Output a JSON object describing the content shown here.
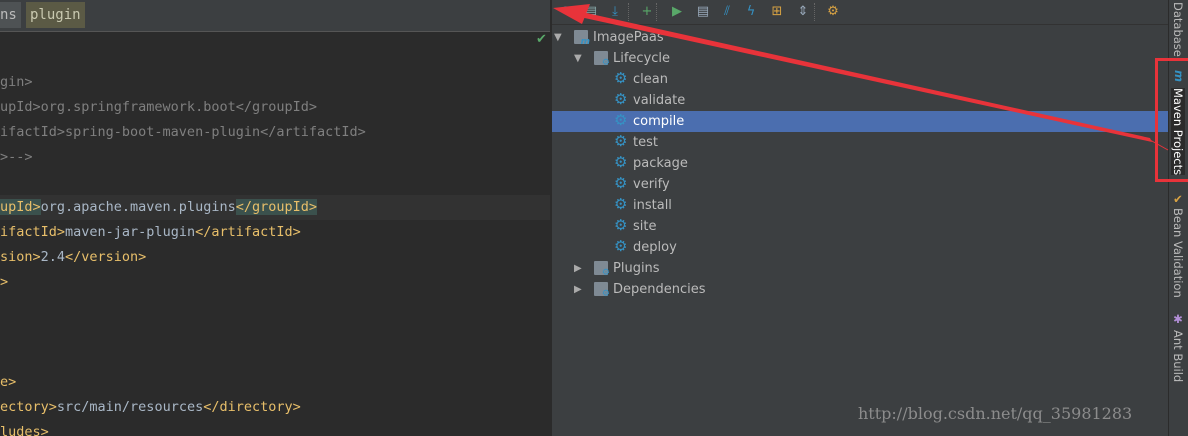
{
  "editor": {
    "tabs": [
      "ns",
      "plugin"
    ],
    "lines": [
      {
        "parts": [
          [
            "cmt",
            "gin>"
          ]
        ]
      },
      {
        "parts": [
          [
            "cmt",
            "upId>org.springframework.boot</groupId>"
          ]
        ]
      },
      {
        "parts": [
          [
            "cmt",
            "ifactId>spring-boot-maven-plugin</artifactId>"
          ]
        ]
      },
      {
        "parts": [
          [
            "cmt",
            ">-->"
          ]
        ]
      },
      {
        "parts": []
      },
      {
        "parts": [
          [
            "tag match",
            "upId>"
          ],
          [
            "txt",
            "org.apache.maven.plugins"
          ],
          [
            "tag match",
            "</groupId>"
          ]
        ],
        "current": true
      },
      {
        "parts": [
          [
            "tag",
            "ifactId>"
          ],
          [
            "txt",
            "maven-jar-plugin"
          ],
          [
            "tag",
            "</artifactId>"
          ]
        ]
      },
      {
        "parts": [
          [
            "tag",
            "sion>"
          ],
          [
            "txt",
            "2.4"
          ],
          [
            "tag",
            "</version>"
          ]
        ]
      },
      {
        "parts": [
          [
            "tag",
            ">"
          ]
        ]
      },
      {
        "parts": []
      },
      {
        "parts": []
      },
      {
        "parts": []
      },
      {
        "parts": [
          [
            "tag",
            "e>"
          ]
        ]
      },
      {
        "parts": [
          [
            "tag",
            "ectory>"
          ],
          [
            "txt",
            "src/main/resources"
          ],
          [
            "tag",
            "</directory>"
          ]
        ]
      },
      {
        "parts": [
          [
            "tag",
            "ludes>"
          ]
        ]
      }
    ]
  },
  "maven": {
    "toolbar": [
      "reimport-icon",
      "generate-sources-icon",
      "download-icon",
      "add-icon",
      "run-icon",
      "execute-goal-icon",
      "skip-tests-icon",
      "offline-icon",
      "show-dependencies-icon",
      "collapse-all-icon",
      "settings-icon"
    ],
    "tree": [
      {
        "label": "ImagePaas",
        "level": 0,
        "expanded": true,
        "icon": "maven-project-icon"
      },
      {
        "label": "Lifecycle",
        "level": 1,
        "expanded": true,
        "icon": "lifecycle-folder-icon"
      },
      {
        "label": "clean",
        "level": 2,
        "icon": "gear-icon"
      },
      {
        "label": "validate",
        "level": 2,
        "icon": "gear-icon"
      },
      {
        "label": "compile",
        "level": 2,
        "icon": "gear-icon",
        "selected": true
      },
      {
        "label": "test",
        "level": 2,
        "icon": "gear-icon"
      },
      {
        "label": "package",
        "level": 2,
        "icon": "gear-icon"
      },
      {
        "label": "verify",
        "level": 2,
        "icon": "gear-icon"
      },
      {
        "label": "install",
        "level": 2,
        "icon": "gear-icon"
      },
      {
        "label": "site",
        "level": 2,
        "icon": "gear-icon"
      },
      {
        "label": "deploy",
        "level": 2,
        "icon": "gear-icon"
      },
      {
        "label": "Plugins",
        "level": 1,
        "expanded": false,
        "icon": "plugins-folder-icon"
      },
      {
        "label": "Dependencies",
        "level": 1,
        "expanded": false,
        "icon": "dependencies-folder-icon"
      }
    ]
  },
  "stripe": {
    "database": "Database",
    "maven_projects": "Maven Projects",
    "bean_validation": "Bean Validation",
    "ant_build": "Ant Build"
  },
  "watermark": "http://blog.csdn.net/qq_35981283",
  "colors": {
    "selection": "#4b6eaf",
    "annotation": "#e8333a"
  }
}
